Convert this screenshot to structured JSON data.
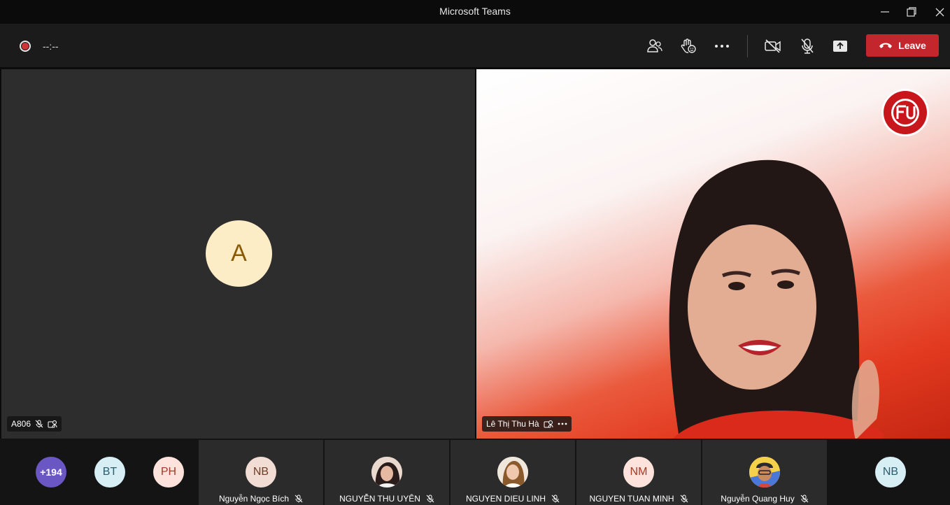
{
  "window": {
    "title": "Microsoft Teams"
  },
  "toolbar": {
    "timer": "--:--",
    "leave_label": "Leave"
  },
  "main": {
    "left_tile": {
      "initial": "A",
      "name": "A806"
    },
    "right_tile": {
      "name": "Lê Thị Thu Hà"
    }
  },
  "strip": {
    "overflow_count": "+194",
    "avatars": [
      {
        "initials": "BT"
      },
      {
        "initials": "PH"
      },
      {
        "initials": "NB"
      }
    ],
    "participants": [
      {
        "initials": "NB",
        "name": "Nguyễn Ngọc Bích"
      },
      {
        "name": "NGUYỄN THU UYÊN"
      },
      {
        "name": "NGUYEN DIEU LINH"
      },
      {
        "initials": "NM",
        "name": "NGUYEN TUAN MINH"
      },
      {
        "name": "Nguyễn Quang Huy"
      }
    ]
  },
  "colors": {
    "leave": "#c4262e",
    "overflow_bubble": "#6b57c4",
    "recording": "#d13438"
  }
}
